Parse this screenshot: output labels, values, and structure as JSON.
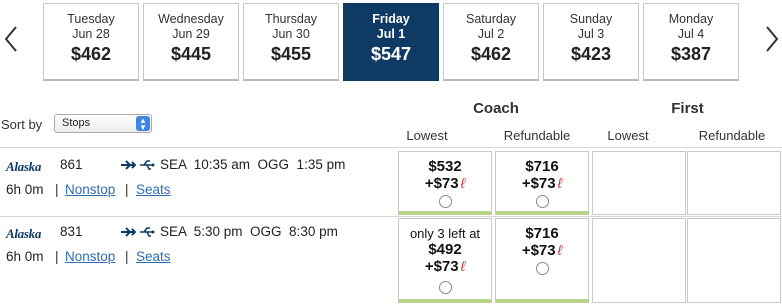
{
  "date_strip": {
    "days": [
      {
        "dow": "Tuesday",
        "md": "Jun 28",
        "price": "$462",
        "selected": false
      },
      {
        "dow": "Wednesday",
        "md": "Jun 29",
        "price": "$445",
        "selected": false
      },
      {
        "dow": "Thursday",
        "md": "Jun 30",
        "price": "$455",
        "selected": false
      },
      {
        "dow": "Friday",
        "md": "Jul 1",
        "price": "$547",
        "selected": true
      },
      {
        "dow": "Saturday",
        "md": "Jul 2",
        "price": "$462",
        "selected": false
      },
      {
        "dow": "Sunday",
        "md": "Jul 3",
        "price": "$423",
        "selected": false
      },
      {
        "dow": "Monday",
        "md": "Jul 4",
        "price": "$387",
        "selected": false
      }
    ],
    "selected_color": "#0e3a63"
  },
  "sort": {
    "label": "Sort by",
    "value": "Stops"
  },
  "cabins": {
    "coach": {
      "label": "Coach",
      "lowest": "Lowest",
      "refundable": "Refundable"
    },
    "first": {
      "label": "First",
      "lowest": "Lowest",
      "refundable": "Refundable"
    }
  },
  "flights": [
    {
      "airline": "Alaska",
      "number": "861",
      "route": "SEA  10:35 am  OGG  1:35 pm",
      "duration": "6h 0m",
      "stops_link": "Nonstop",
      "seats_link": "Seats",
      "separator": "|",
      "coach_lowest": {
        "note": "",
        "amount": "$532",
        "tax": "+$73"
      },
      "coach_refundable": {
        "amount": "$716",
        "tax": "+$73"
      }
    },
    {
      "airline": "Alaska",
      "number": "831",
      "route": "SEA  5:30 pm  OGG  8:30 pm",
      "duration": "6h 0m",
      "stops_link": "Nonstop",
      "seats_link": "Seats",
      "separator": "|",
      "coach_lowest": {
        "note": "only 3 left at",
        "amount": "$492",
        "tax": "+$73"
      },
      "coach_refundable": {
        "amount": "$716",
        "tax": "+$73"
      }
    }
  ],
  "icons": {
    "prev": "chevron-left-icon",
    "next": "chevron-right-icon",
    "plane": "plane-icon",
    "power": "power-usb-icon",
    "fee": "fee-leaf-icon"
  },
  "fee_glyph": "ℓ",
  "colors": {
    "link": "#2d6db5",
    "fare_accent": "#b8d48c",
    "fee_mark": "#c0392b"
  }
}
